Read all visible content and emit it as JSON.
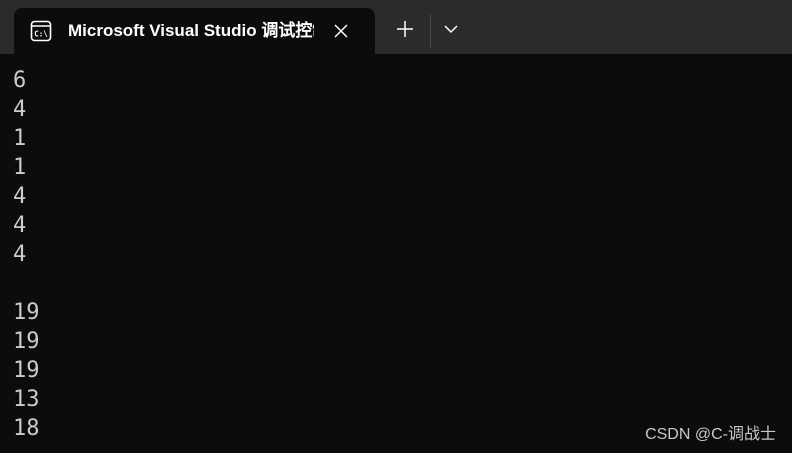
{
  "window": {
    "tab_title": "Microsoft Visual Studio 调试控制台",
    "tab_icon": "console-app-icon",
    "close_icon": "close-icon",
    "new_tab_icon": "plus-icon",
    "dropdown_icon": "chevron-down-icon"
  },
  "console": {
    "lines": [
      "6",
      "4",
      "1",
      "1",
      "4",
      "4",
      "4",
      "",
      "19",
      "19",
      "19",
      "13",
      "18"
    ]
  },
  "watermark": "CSDN @C-调战士",
  "colors": {
    "titlebar": "#2b2b2b",
    "background": "#0c0c0c",
    "text": "#cccccc"
  }
}
